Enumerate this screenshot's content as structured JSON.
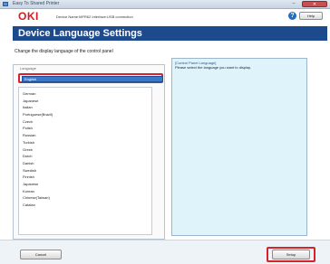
{
  "window": {
    "title": "Easy To Shared Printer",
    "minimize_label": "–",
    "close_label": "✕"
  },
  "header": {
    "logo": "OKI",
    "device_info": "Device Name:MFR62 Interface:USB connection",
    "help_label": "Help"
  },
  "page": {
    "title": "Device Language Settings",
    "instruction": "Change the display language of the control panel"
  },
  "language": {
    "group_legend": "Language",
    "current": "English",
    "options": [
      "German",
      "Japanese",
      "Italian",
      "Portuguese(Brazil)",
      "Czech",
      "Polish",
      "Russian",
      "Turkish",
      "Greek",
      "Dutch",
      "Danish",
      "Swedish",
      "Finnish",
      "Japanese",
      "Korean",
      "Chinese(Taiwan)",
      "Catalan"
    ]
  },
  "description": {
    "title": "[Control Panel Language]",
    "text": "Please select the language you want to display."
  },
  "footer": {
    "cancel_label": "Cancel",
    "setup_label": "Setup"
  },
  "colors": {
    "banner": "#1d4a8c",
    "highlight": "#d6222b",
    "description_bg": "#dff3fb"
  }
}
